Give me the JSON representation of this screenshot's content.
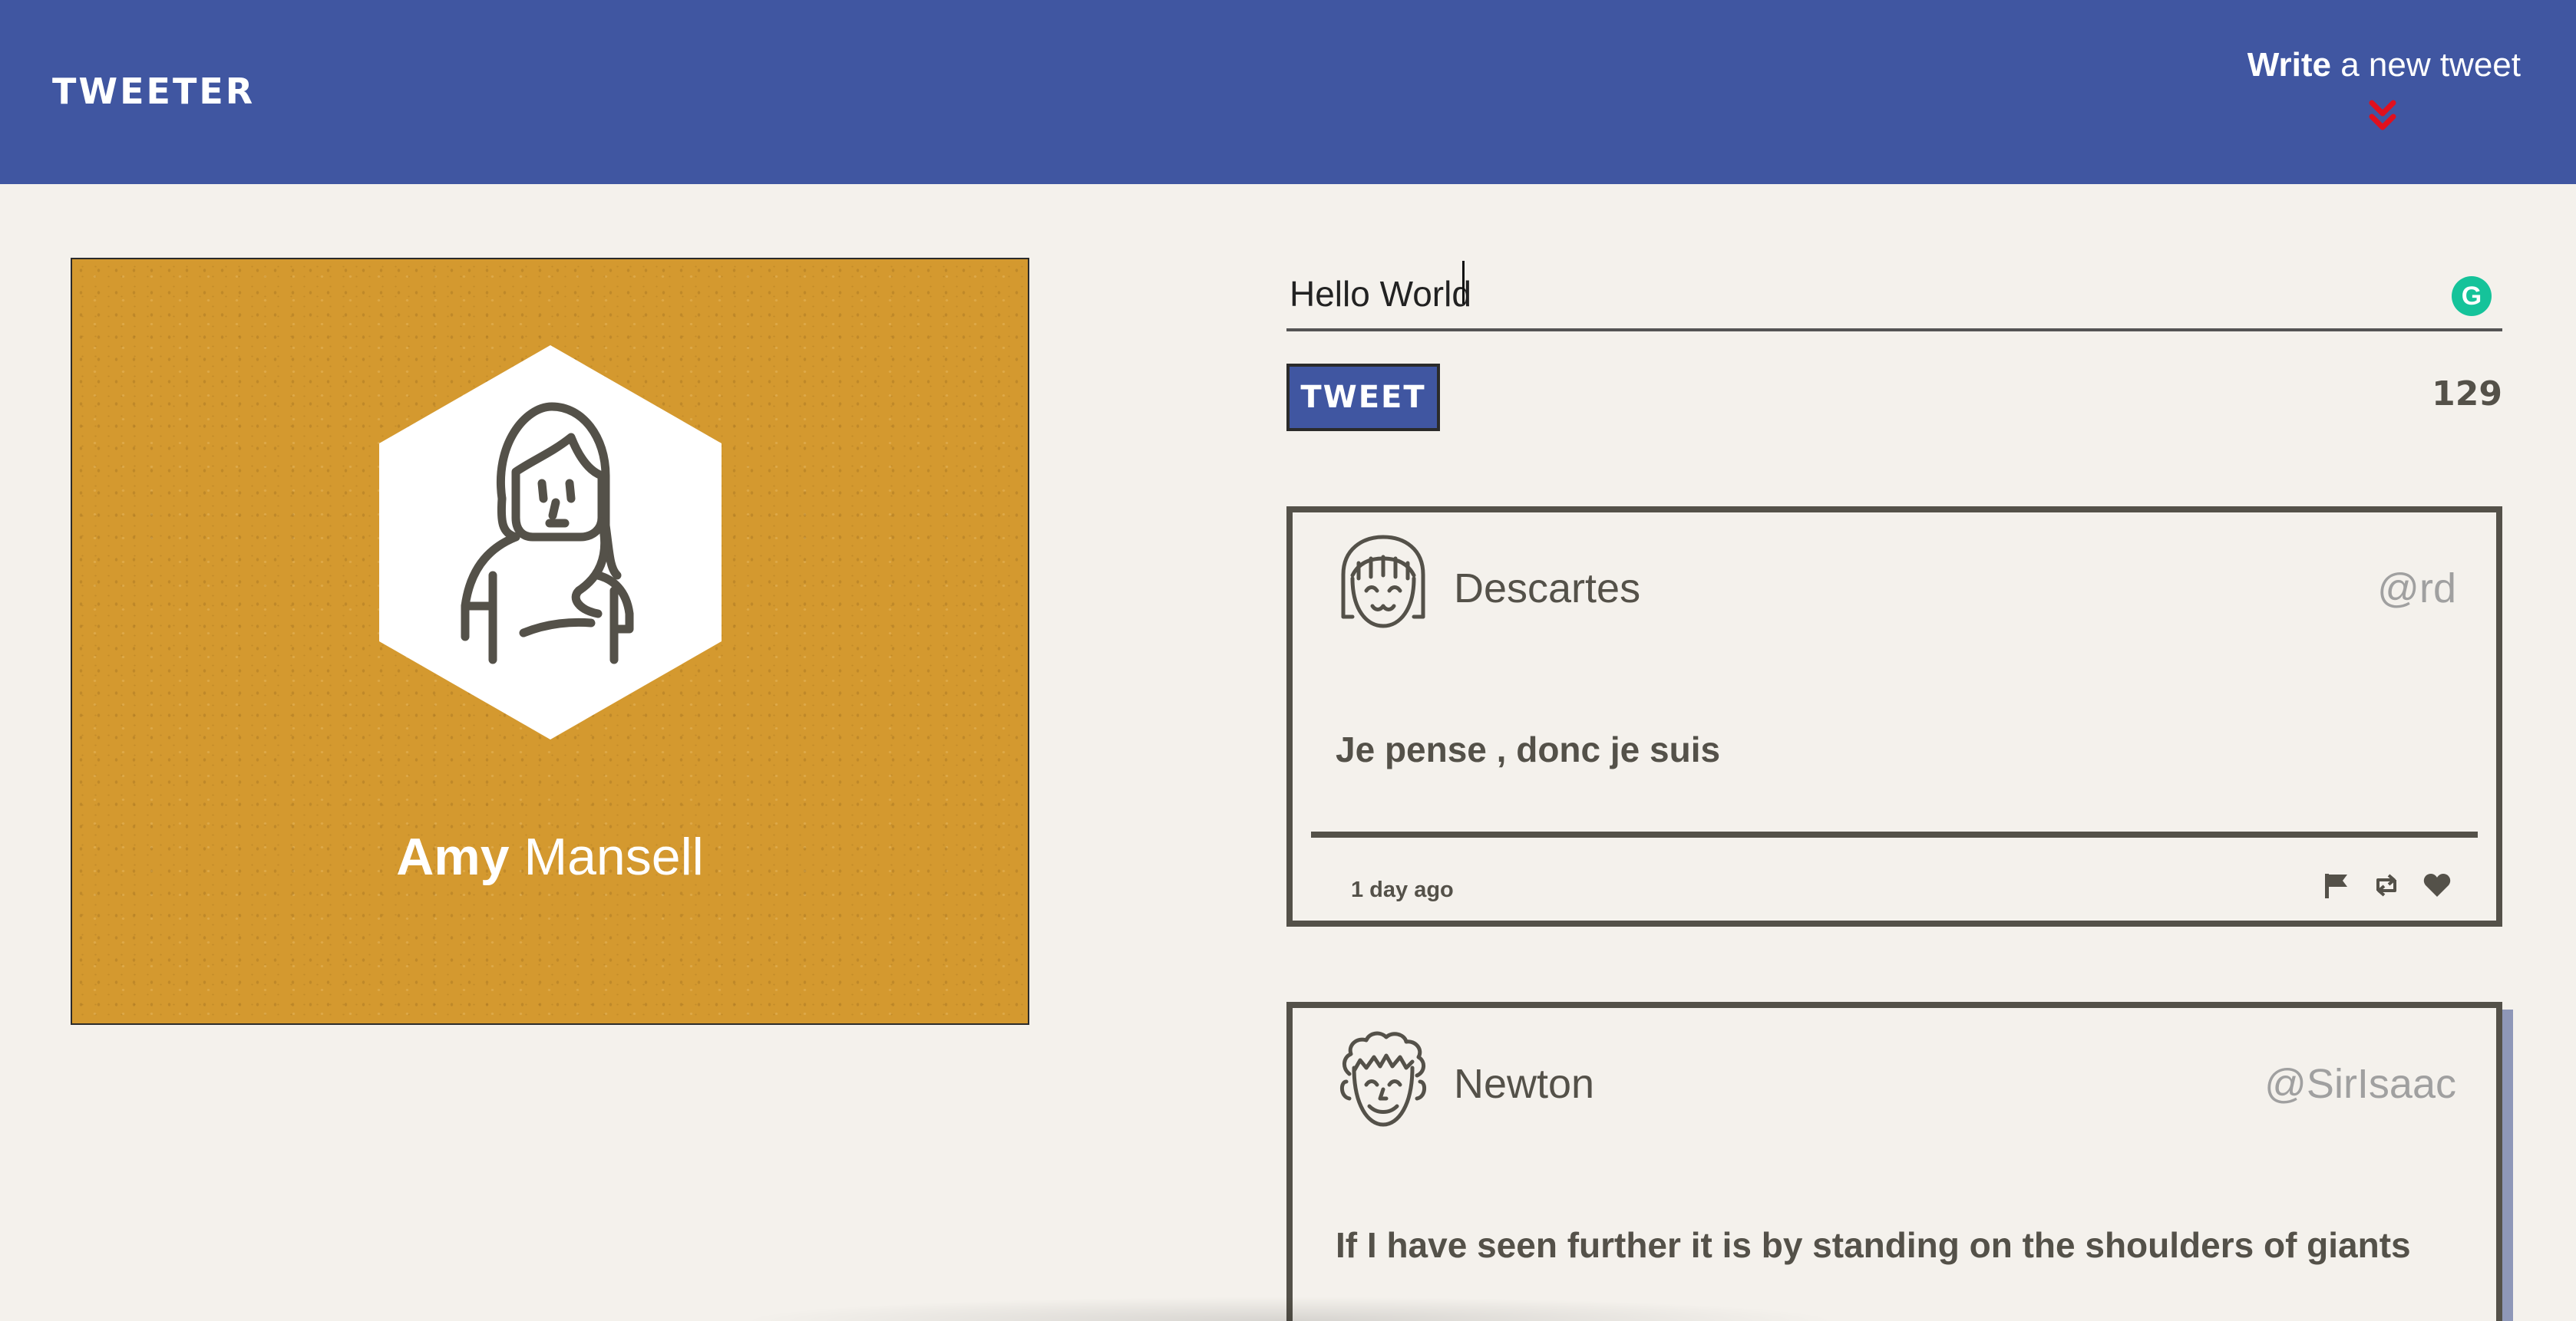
{
  "header": {
    "brand": "TWEETER",
    "compose_toggle_bold": "Write",
    "compose_toggle_rest": " a new tweet",
    "arrow_icon": "double-chevron-down-icon",
    "arrow_color": "#e0101e",
    "background": "#4056a1"
  },
  "profile": {
    "first_name": "Amy",
    "last_name": " Mansell",
    "avatar_icon": "woman-avatar-icon",
    "card_color": "#d4992f"
  },
  "compose": {
    "input_value": "Hello World",
    "grammarly_badge": "G",
    "tweet_button": "TWEET",
    "char_counter": "129"
  },
  "tweets": [
    {
      "name": "Descartes",
      "handle": "@rd",
      "text": "Je pense , donc je suis",
      "time": "1 day ago",
      "avatar_icon": "girl-avatar-icon",
      "actions": [
        "flag-icon",
        "retweet-icon",
        "heart-icon"
      ]
    },
    {
      "name": "Newton",
      "handle": "@SirIsaac",
      "text": "If I have seen further it is by standing on the shoulders of giants",
      "avatar_icon": "curly-hair-man-avatar-icon"
    }
  ]
}
